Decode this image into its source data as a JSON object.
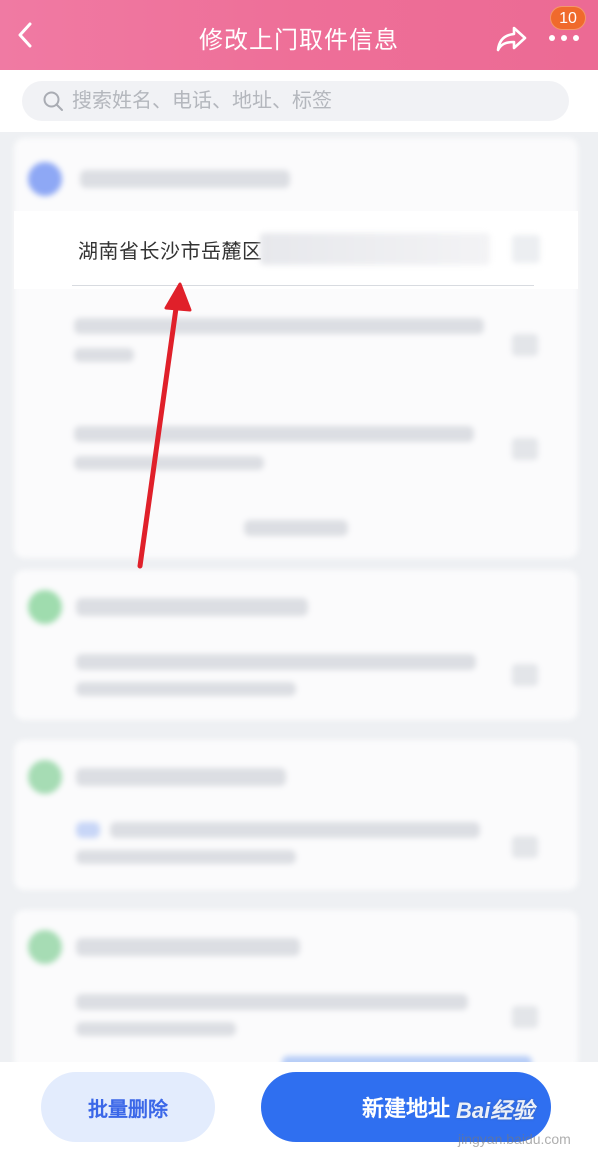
{
  "header": {
    "title": "修改上门取件信息",
    "badge_count": "10"
  },
  "search": {
    "placeholder": "搜索姓名、电话、地址、标签"
  },
  "address_row": {
    "address_text": "湖南省长沙市岳麓区"
  },
  "bottom": {
    "batch_delete_label": "批量删除",
    "new_address_label": "新建地址"
  },
  "watermark": {
    "brand": "Bai经验",
    "url": "jingyan.baidu.com"
  },
  "colors": {
    "header_pink": "#ee6f98",
    "badge_orange": "#f06a2c",
    "primary_blue": "#2f6ff0",
    "secondary_blue_bg": "#e3ecfd",
    "arrow_red": "#e0202a"
  }
}
